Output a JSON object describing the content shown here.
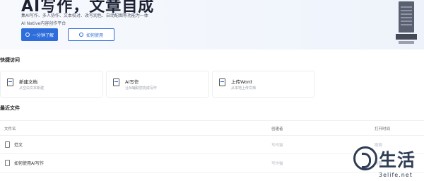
{
  "hero": {
    "title": "AI写作，文章自成",
    "subtitle": "集AI写作、多人协作、文本校对、改写润色、自动配图等功能为一体",
    "tagline": "AI Native内容创作平台",
    "primary_button": "一分钟了解",
    "secondary_button": "如何使用"
  },
  "quick_access": {
    "title": "快捷访问",
    "cards": [
      {
        "title": "新建文档",
        "desc": "从空白文本新建"
      },
      {
        "title": "AI写作",
        "desc": "让AI辅助您完成写作"
      },
      {
        "title": "上传Word",
        "desc": "从本地上传文档"
      }
    ]
  },
  "recent_files": {
    "title": "最近文件",
    "columns": {
      "name": "文件名",
      "creator": "创建者",
      "time": "打开时间"
    },
    "rows": [
      {
        "name": "范文",
        "creator": "写作猫",
        "time": "刚刚"
      },
      {
        "name": "如何使用AI写作",
        "creator": "写作猫",
        "time": "刚刚"
      }
    ]
  },
  "watermark": {
    "text": "生活",
    "url": "3elife.net"
  },
  "colors": {
    "accent": "#2d6ddc",
    "hero_bg": "#eef3fb"
  }
}
